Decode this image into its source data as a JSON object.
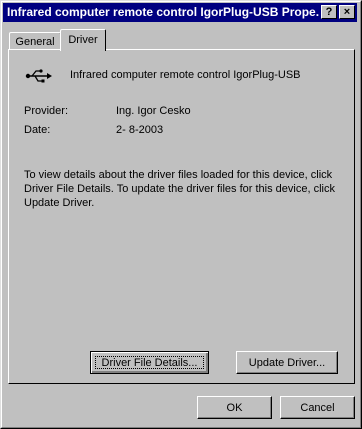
{
  "window": {
    "title": "Infrared computer remote control IgorPlug-USB Prope...",
    "help_button": "?",
    "close_button": "×"
  },
  "tabs": [
    {
      "label": "General"
    },
    {
      "label": "Driver"
    }
  ],
  "driver": {
    "device_name": "Infrared computer remote control IgorPlug-USB",
    "device_icon": "usb-icon",
    "provider_label": "Provider:",
    "provider_value": "Ing. Igor Cesko",
    "date_label": "Date:",
    "date_value": "2- 8-2003",
    "description": "To view details about the driver files loaded for this device, click Driver File Details.  To update the driver files for this device, click Update Driver.",
    "file_details_button": "Driver File Details...",
    "update_button": "Update Driver..."
  },
  "footer": {
    "ok": "OK",
    "cancel": "Cancel"
  }
}
